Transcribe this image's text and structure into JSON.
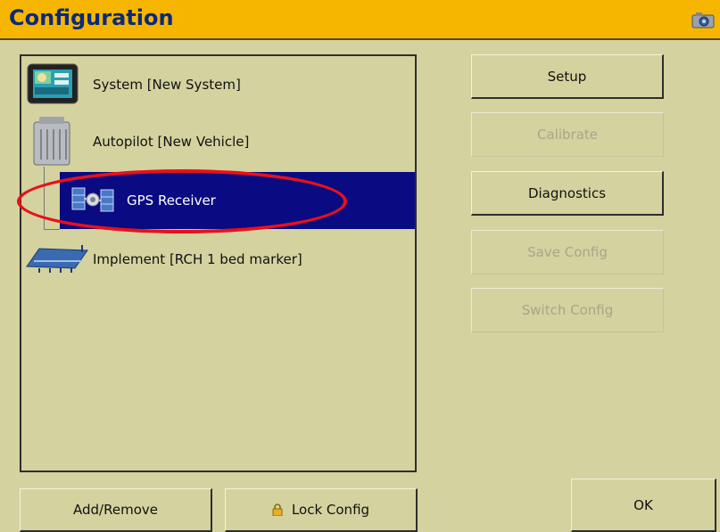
{
  "window": {
    "title": "Configuration",
    "camera_icon": "camera-icon"
  },
  "tree": {
    "items": [
      {
        "label": "System [New System]",
        "icon": "display-terminal-icon"
      },
      {
        "label": "Autopilot [New Vehicle]",
        "icon": "controller-box-icon"
      },
      {
        "label": "GPS Receiver",
        "icon": "satellite-icon",
        "selected": true
      },
      {
        "label": "Implement [RCH 1 bed marker]",
        "icon": "implement-icon"
      }
    ]
  },
  "actions": {
    "setup": "Setup",
    "calibrate": "Calibrate",
    "diagnostics": "Diagnostics",
    "save_config": "Save Config",
    "switch_config": "Switch Config"
  },
  "footer": {
    "add_remove": "Add/Remove",
    "lock_config": "Lock Config",
    "ok": "OK"
  },
  "colors": {
    "title_bar": "#f6b600",
    "title_text": "#0c2a7a",
    "background": "#d4d29f",
    "selection": "#0a0a82",
    "highlight_ring": "#e8111a"
  }
}
